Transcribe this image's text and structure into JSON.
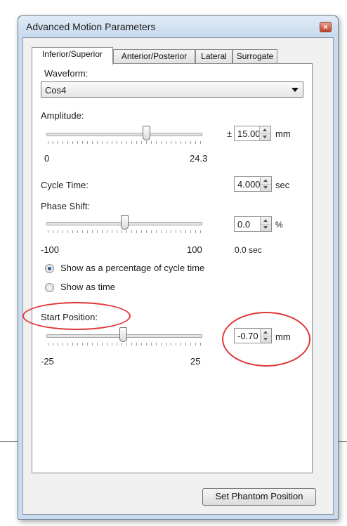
{
  "window": {
    "title": "Advanced Motion Parameters",
    "close_glyph": "×"
  },
  "tabs": [
    {
      "label": "Inferior/Superior",
      "active": true
    },
    {
      "label": "Anterior/Posterior",
      "active": false
    },
    {
      "label": "Lateral",
      "active": false
    },
    {
      "label": "Surrogate",
      "active": false
    }
  ],
  "waveform": {
    "label": "Waveform:",
    "value": "Cos4"
  },
  "amplitude": {
    "label": "Amplitude:",
    "prefix": "±",
    "value": "15.00",
    "unit": "mm",
    "min": "0",
    "max": "24.3",
    "slider_value": 15.0
  },
  "cycle_time": {
    "label": "Cycle Time:",
    "value": "4.000",
    "unit": "sec"
  },
  "phase_shift": {
    "label": "Phase Shift:",
    "value": "0.0",
    "unit": "%",
    "min": "-100",
    "max": "100",
    "seconds": "0.0 sec",
    "slider_value": 0
  },
  "display_mode": {
    "option_percent": "Show as a percentage of cycle time",
    "option_time": "Show as time",
    "selected": "percent"
  },
  "start_position": {
    "label": "Start Position:",
    "value": "-0.70",
    "unit": "mm",
    "min": "-25",
    "max": "25",
    "slider_value": -0.7
  },
  "footer": {
    "set_phantom_label": "Set Phantom Position"
  },
  "colors": {
    "annotation": "#e03636",
    "window_frame": "#c9dcef"
  }
}
